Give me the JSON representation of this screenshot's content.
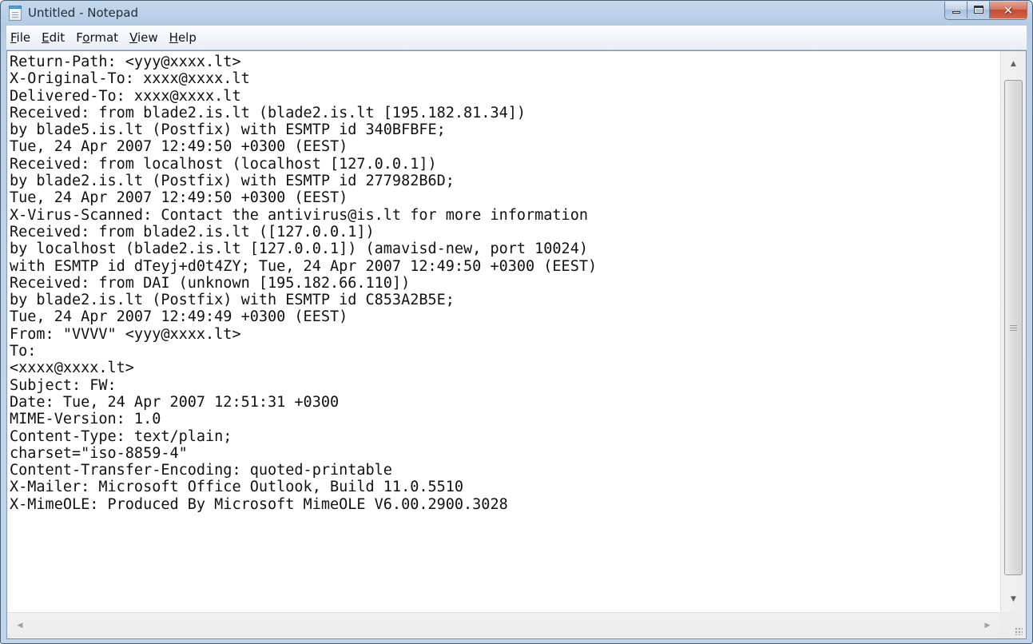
{
  "window": {
    "title": "Untitled - Notepad"
  },
  "caption_buttons": {
    "close_symbol": "✕"
  },
  "menu": {
    "items": [
      {
        "label": "File",
        "mnemonic": "F",
        "rest": "ile"
      },
      {
        "label": "Edit",
        "mnemonic": "E",
        "rest": "dit"
      },
      {
        "label": "Format",
        "pre": "F",
        "mnemonic": "o",
        "rest": "rmat"
      },
      {
        "label": "View",
        "mnemonic": "V",
        "rest": "iew"
      },
      {
        "label": "Help",
        "mnemonic": "H",
        "rest": "elp"
      }
    ]
  },
  "editor": {
    "lines": [
      "Return-Path: <yyy@xxxx.lt>",
      "X-Original-To: xxxx@xxxx.lt",
      "Delivered-To: xxxx@xxxx.lt",
      "Received: from blade2.is.lt (blade2.is.lt [195.182.81.34])",
      "by blade5.is.lt (Postfix) with ESMTP id 340BFBFE;",
      "Tue, 24 Apr 2007 12:49:50 +0300 (EEST)",
      "Received: from localhost (localhost [127.0.0.1])",
      "by blade2.is.lt (Postfix) with ESMTP id 277982B6D;",
      "Tue, 24 Apr 2007 12:49:50 +0300 (EEST)",
      "X-Virus-Scanned: Contact the antivirus@is.lt for more information",
      "Received: from blade2.is.lt ([127.0.0.1])",
      "by localhost (blade2.is.lt [127.0.0.1]) (amavisd-new, port 10024)",
      "with ESMTP id dTeyj+d0t4ZY; Tue, 24 Apr 2007 12:49:50 +0300 (EEST)",
      "Received: from DAI (unknown [195.182.66.110])",
      "by blade2.is.lt (Postfix) with ESMTP id C853A2B5E;",
      "Tue, 24 Apr 2007 12:49:49 +0300 (EEST)",
      "From: \"VVVV\" <yyy@xxxx.lt>",
      "To:",
      "<xxxx@xxxx.lt>",
      "Subject: FW:",
      "Date: Tue, 24 Apr 2007 12:51:31 +0300",
      "MIME-Version: 1.0",
      "Content-Type: text/plain;",
      "charset=\"iso-8859-4\"",
      "Content-Transfer-Encoding: quoted-printable",
      "X-Mailer: Microsoft Office Outlook, Build 11.0.5510",
      "X-MimeOLE: Produced By Microsoft MimeOLE V6.00.2900.3028"
    ]
  },
  "icons": {
    "app": "notepad-icon",
    "minimize": "minimize-icon",
    "maximize": "maximize-icon",
    "close": "close-icon",
    "scroll_up": "scroll-up-arrow-icon",
    "scroll_down": "scroll-down-arrow-icon",
    "scroll_left": "scroll-left-arrow-icon",
    "scroll_right": "scroll-right-arrow-icon",
    "grip": "scrollbar-grip-icon",
    "size_grip": "size-grip-icon"
  },
  "colors": {
    "frame": "#b9cfe7",
    "close_button": "#c94b31",
    "text": "#111111",
    "editor_background": "#ffffff"
  }
}
